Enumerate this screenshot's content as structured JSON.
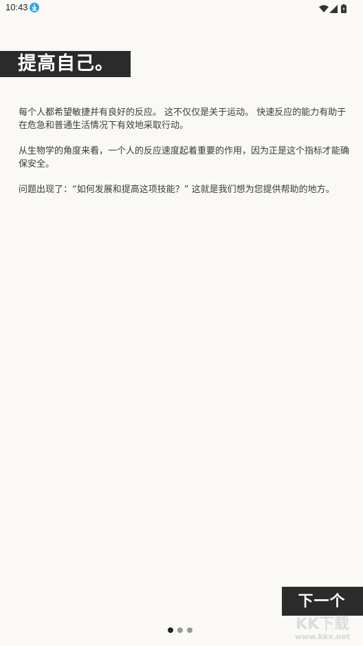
{
  "status_bar": {
    "time": "10:43"
  },
  "intro": {
    "title": "提高自己。",
    "paragraphs": [
      "每个人都希望敏捷并有良好的反应。 这不仅仅是关于运动。 快速反应的能力有助于在危急和普通生活情况下有效地采取行动。",
      "从生物学的角度来看，一个人的反应速度起着重要的作用，因为正是这个指标才能确保安全。",
      "问题出现了：“如何发展和提高这项技能？” 这就是我们想为您提供帮助的地方。"
    ],
    "next_label": "下一个"
  },
  "pager": {
    "total": 3,
    "current": 1
  },
  "watermark": {
    "text": "KK下载",
    "url": "www.kkx.net"
  },
  "colors": {
    "background": "#faf9f5",
    "banner": "#2b2b2b",
    "accent_download": "#2aa6e8"
  }
}
